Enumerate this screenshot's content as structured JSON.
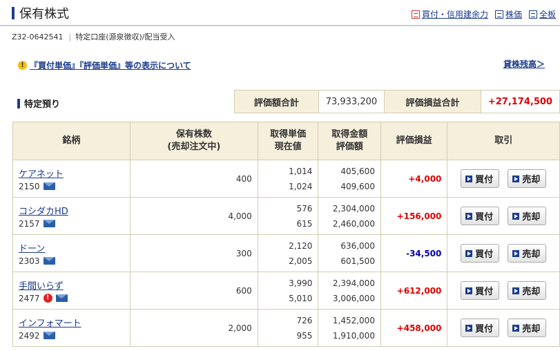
{
  "header": {
    "title": "保有株式",
    "links": [
      {
        "label": "買付・信用建余力",
        "icon": "account-doc-icon"
      },
      {
        "label": "株価",
        "icon": "list-icon"
      },
      {
        "label": "全板",
        "icon": "list-icon"
      }
    ]
  },
  "account": {
    "number": "Z32-0642541",
    "type": "特定口座(源泉徴収)/配当受入"
  },
  "notice": {
    "text": "『買付単価』『評価単価』等の表示について",
    "lending_link": "貸株残高＞"
  },
  "section": {
    "title": "特定預り"
  },
  "summary": {
    "total_value_label": "評価額合計",
    "total_value": "73,933,200",
    "total_pl_label": "評価損益合計",
    "total_pl": "+27,174,500"
  },
  "table": {
    "headers": {
      "name": "銘柄",
      "qty_1": "保有株数",
      "qty_2": "(売却注文中)",
      "price_1": "取得単価",
      "price_2": "現在値",
      "amount_1": "取得金額",
      "amount_2": "評価額",
      "pl": "評価損益",
      "action": "取引"
    },
    "buy_label": "買付",
    "sell_label": "売却",
    "rows": [
      {
        "name": "ケアネット",
        "code": "2150",
        "qty": "400",
        "cost_price": "1,014",
        "current_price": "1,024",
        "cost_amount": "405,600",
        "value_amount": "409,600",
        "pl": "+4,000",
        "alert": false
      },
      {
        "name": "コシダカHD",
        "code": "2157",
        "qty": "4,000",
        "cost_price": "576",
        "current_price": "615",
        "cost_amount": "2,304,000",
        "value_amount": "2,460,000",
        "pl": "+156,000",
        "alert": false
      },
      {
        "name": "ドーン",
        "code": "2303",
        "qty": "300",
        "cost_price": "2,120",
        "current_price": "2,005",
        "cost_amount": "636,000",
        "value_amount": "601,500",
        "pl": "-34,500",
        "alert": false
      },
      {
        "name": "手間いらず",
        "code": "2477",
        "qty": "600",
        "cost_price": "3,990",
        "current_price": "5,010",
        "cost_amount": "2,394,000",
        "value_amount": "3,006,000",
        "pl": "+612,000",
        "alert": true
      },
      {
        "name": "インフォマート",
        "code": "2492",
        "qty": "2,000",
        "cost_price": "726",
        "current_price": "955",
        "cost_amount": "1,452,000",
        "value_amount": "1,910,000",
        "pl": "+458,000",
        "alert": false
      }
    ]
  }
}
